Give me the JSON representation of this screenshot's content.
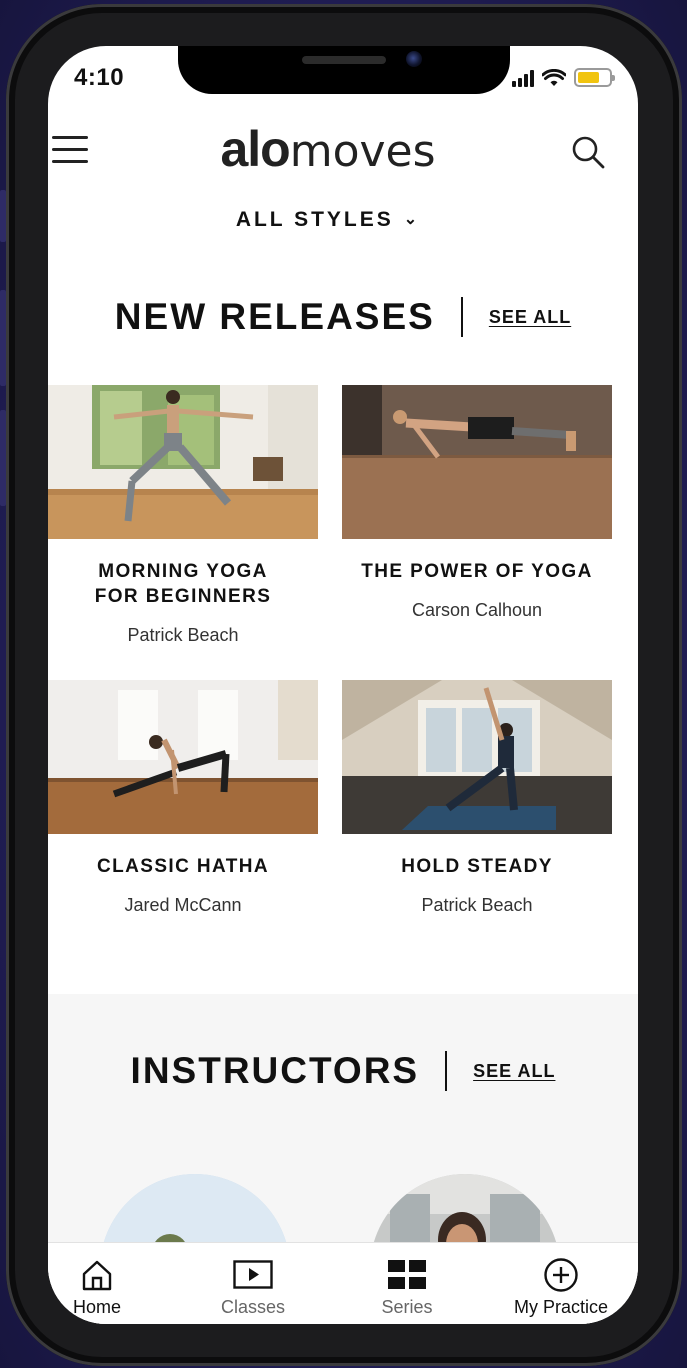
{
  "status_bar": {
    "time": "4:10",
    "battery_color": "#f1c40f"
  },
  "header": {
    "menu_icon": "hamburger-menu-icon",
    "logo_bold": "alo",
    "logo_light": "moves",
    "search_icon": "search-icon",
    "styles_filter": "ALL STYLES"
  },
  "new_releases": {
    "title": "NEW RELEASES",
    "see_all": "SEE ALL",
    "cards": [
      {
        "title_line1": "MORNING YOGA",
        "title_line2": "FOR BEGINNERS",
        "instructor": "Patrick Beach"
      },
      {
        "title_line1": "THE POWER OF YOGA",
        "title_line2": "",
        "instructor": "Carson Calhoun"
      },
      {
        "title_line1": "CLASSIC HATHA",
        "title_line2": "",
        "instructor": "Jared McCann"
      },
      {
        "title_line1": "HOLD STEADY",
        "title_line2": "",
        "instructor": "Patrick Beach"
      }
    ]
  },
  "instructors": {
    "title": "INSTRUCTORS",
    "see_all": "SEE ALL"
  },
  "tabbar": {
    "tabs": [
      {
        "label": "Home",
        "icon": "home-icon"
      },
      {
        "label": "Classes",
        "icon": "play-icon"
      },
      {
        "label": "Series",
        "icon": "grid-icon"
      },
      {
        "label": "My Practice",
        "icon": "plus-circle-icon"
      }
    ]
  }
}
